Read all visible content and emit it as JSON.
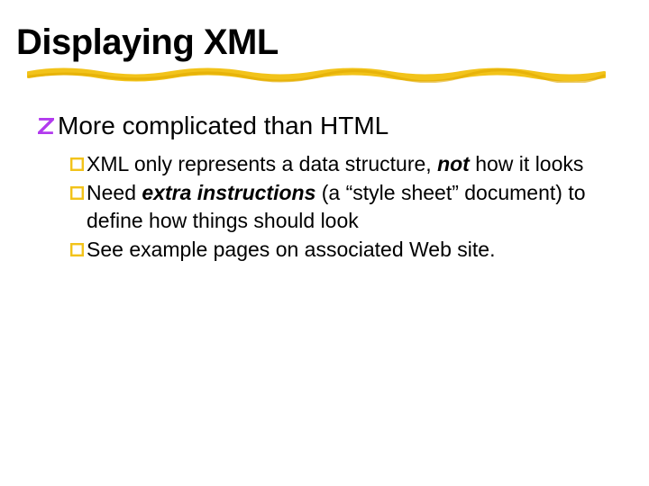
{
  "slide": {
    "title": "Displaying XML",
    "level1": {
      "text": "More complicated than HTML"
    },
    "level2": {
      "item1_a": "XML only represents a data structure, ",
      "item1_b": "not",
      "item1_c": " how it looks",
      "item2_a": "Need ",
      "item2_b": "extra instructions",
      "item2_c": " (a “style sheet” document) to define how things should look",
      "item3": "See example pages on associated Web site."
    }
  }
}
